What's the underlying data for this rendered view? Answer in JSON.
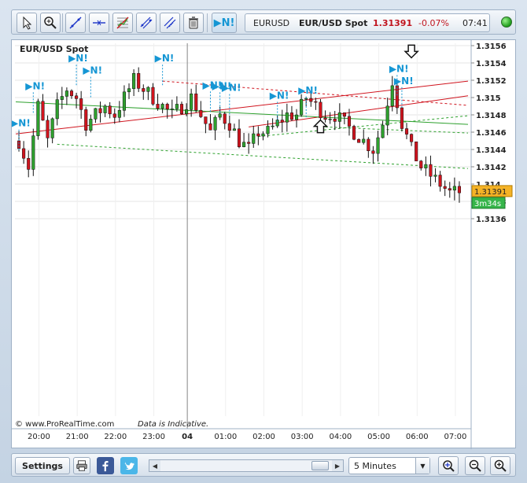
{
  "toolbar": {
    "ni_label": "▶N!"
  },
  "quote": {
    "symbol": "EURUSD",
    "name": "EUR/USD Spot",
    "price": "1.31391",
    "change": "-0.07%",
    "time": "07:41"
  },
  "chart": {
    "title": "EUR/USD Spot",
    "watermark_site": "© www.ProRealTime.com",
    "watermark_note": "Data is Indicative.",
    "current_price_label": "1.31391",
    "countdown_label": "3m34s",
    "news_label": "▶N!"
  },
  "chart_data": {
    "type": "candlestick",
    "title": "EUR/USD Spot",
    "ylim": [
      1.3134,
      1.3157
    ],
    "y_ticks": [
      "1.3156",
      "1.3154",
      "1.3152",
      "1.315",
      "1.3148",
      "1.3146",
      "1.3144",
      "1.3142",
      "1.314",
      "1.3138",
      "1.3136"
    ],
    "x_ticks": [
      "20:00",
      "21:00",
      "22:00",
      "23:00",
      "04",
      "01:00",
      "02:00",
      "03:00",
      "04:00",
      "05:00",
      "06:00",
      "07:00"
    ],
    "day_separator_label": "04",
    "grid": true,
    "last_price": 1.31391,
    "close_path": [
      [
        0,
        1.3145
      ],
      [
        2,
        1.3142
      ],
      [
        4,
        1.3149
      ],
      [
        6,
        1.3145
      ],
      [
        8,
        1.3149
      ],
      [
        10,
        1.3151
      ],
      [
        12,
        1.315
      ],
      [
        14,
        1.3147
      ],
      [
        16,
        1.3148
      ],
      [
        18,
        1.3149
      ],
      [
        20,
        1.3148
      ],
      [
        22,
        1.315
      ],
      [
        24,
        1.3152
      ],
      [
        26,
        1.3151
      ],
      [
        28,
        1.315
      ],
      [
        30,
        1.3149
      ],
      [
        32,
        1.3148
      ],
      [
        34,
        1.3149
      ],
      [
        36,
        1.315
      ],
      [
        38,
        1.3148
      ],
      [
        40,
        1.3146
      ],
      [
        42,
        1.3148
      ],
      [
        44,
        1.3147
      ],
      [
        46,
        1.3145
      ],
      [
        48,
        1.3144
      ],
      [
        50,
        1.3146
      ],
      [
        52,
        1.3146
      ],
      [
        54,
        1.3147
      ],
      [
        56,
        1.3148
      ],
      [
        58,
        1.3148
      ],
      [
        60,
        1.315
      ],
      [
        62,
        1.3149
      ],
      [
        64,
        1.3148
      ],
      [
        66,
        1.3148
      ],
      [
        68,
        1.3147
      ],
      [
        70,
        1.3146
      ],
      [
        72,
        1.3145
      ],
      [
        74,
        1.3144
      ],
      [
        76,
        1.3147
      ],
      [
        78,
        1.3152
      ],
      [
        80,
        1.3147
      ],
      [
        82,
        1.3144
      ],
      [
        84,
        1.3142
      ],
      [
        86,
        1.3141
      ],
      [
        88,
        1.314
      ],
      [
        90,
        1.3139
      ],
      [
        92,
        1.31391
      ]
    ],
    "lines": [
      {
        "name": "red-trend-1",
        "color": "#d0141e",
        "style": "solid",
        "points": [
          [
            0,
            1.31458
          ],
          [
            92,
            1.31519
          ]
        ]
      },
      {
        "name": "red-trend-2",
        "color": "#d0141e",
        "style": "solid",
        "points": [
          [
            48,
            1.31466
          ],
          [
            92,
            1.31502
          ]
        ]
      },
      {
        "name": "red-trend-dotted",
        "color": "#d0141e",
        "style": "dashed",
        "points": [
          [
            30,
            1.31519
          ],
          [
            92,
            1.31491
          ]
        ]
      },
      {
        "name": "green-trend-solid",
        "color": "#2ea12e",
        "style": "solid",
        "points": [
          [
            0,
            1.31495
          ],
          [
            92,
            1.31469
          ]
        ]
      },
      {
        "name": "green-trend-dashed-1",
        "color": "#2ea12e",
        "style": "dashed",
        "points": [
          [
            8,
            1.31446
          ],
          [
            92,
            1.31418
          ]
        ]
      },
      {
        "name": "green-trend-dashed-2",
        "color": "#2ea12e",
        "style": "dashed",
        "points": [
          [
            50,
            1.31455
          ],
          [
            92,
            1.31479
          ]
        ]
      },
      {
        "name": "green-trend-dashed-3",
        "color": "#2ea12e",
        "style": "dashed",
        "points": [
          [
            64,
            1.31466
          ],
          [
            92,
            1.31459
          ]
        ]
      }
    ],
    "news_markers": [
      {
        "i": 0,
        "price": 1.31463
      },
      {
        "i": 3,
        "price": 1.31506
      },
      {
        "i": 12,
        "price": 1.31538
      },
      {
        "i": 15,
        "price": 1.31524
      },
      {
        "i": 30,
        "price": 1.31538
      },
      {
        "i": 40,
        "price": 1.31507
      },
      {
        "i": 42,
        "price": 1.31506
      },
      {
        "i": 44,
        "price": 1.31504
      },
      {
        "i": 54,
        "price": 1.31495
      },
      {
        "i": 60,
        "price": 1.31501
      },
      {
        "i": 79,
        "price": 1.31526
      },
      {
        "i": 80,
        "price": 1.31512
      }
    ],
    "arrows": [
      {
        "direction": "up",
        "i": 63,
        "price": 1.31474
      },
      {
        "direction": "down",
        "i": 82,
        "price": 1.31546
      }
    ]
  },
  "bottombar": {
    "settings_label": "Settings",
    "timeframe": "5 Minutes"
  },
  "colors": {
    "up_candle": "#2ea12e",
    "down_candle": "#d0141e",
    "news_marker": "#1596d4",
    "price_label_bg": "#f5b326",
    "countdown_bg": "#36b54a",
    "change_negative": "#c0141e"
  }
}
